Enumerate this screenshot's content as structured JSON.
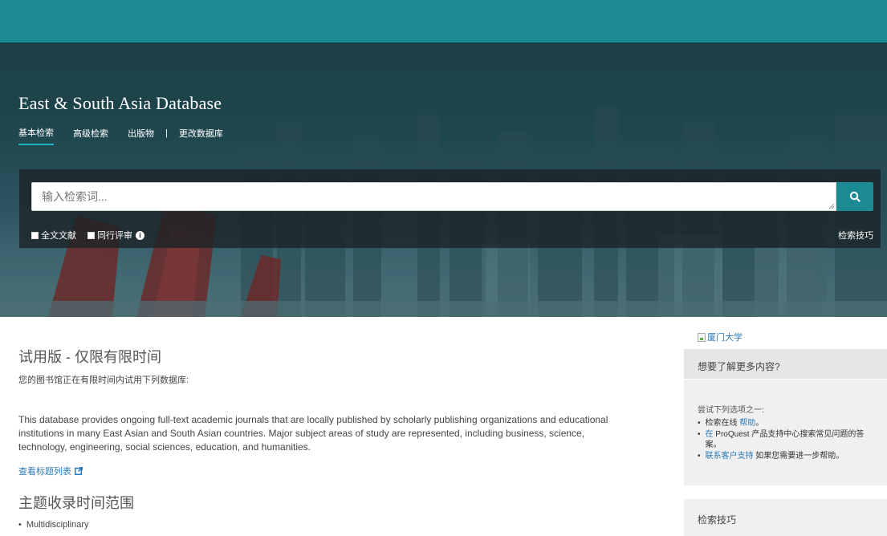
{
  "header": {
    "db_title": "East & South Asia Database",
    "nav": [
      {
        "label": "基本检索",
        "active": true
      },
      {
        "label": "高级检索"
      },
      {
        "label": "出版物"
      },
      {
        "label": "|"
      },
      {
        "label": "更改数据库"
      }
    ]
  },
  "search": {
    "placeholder": "输入检索词...",
    "options": [
      "全文文献",
      "同行评审"
    ],
    "tips_label": "检索技巧",
    "info_icon_glyph": "i"
  },
  "main": {
    "trial_title": "试用版 - 仅限有限时间",
    "trial_sub": "您的图书馆正在有限时间内试用下列数据库:",
    "description": "This database provides ongoing full-text academic journals that are locally published by scholarly publishing organizations and educational institutions in many East Asian and South Asian countries. Major subject areas of study are represented, including business, science, technology, engineering, social sciences, education, and humanities.",
    "title_list_link": "查看标题列表",
    "coverage_title": "主题收录时间范围",
    "coverage_items": [
      "Multidisciplinary"
    ]
  },
  "sidebar": {
    "logo_alt": "厦门大学",
    "more_title": "想要了解更多内容?",
    "try_text": "尝试下列选项之一:",
    "items": [
      {
        "pre": "检索在线 ",
        "link": "帮助",
        "post": "。"
      },
      {
        "pre": "",
        "link": "在",
        "post": " ProQuest 产品支持中心搜索常见问题的答案。"
      },
      {
        "pre": "",
        "link": "联系客户支持",
        "post": " 如果您需要进一步帮助。"
      }
    ],
    "tips_title": "检索技巧"
  },
  "colors": {
    "teal": "#1b8a93",
    "hero_dark": "#1f474e",
    "link": "#2b7ab9"
  }
}
